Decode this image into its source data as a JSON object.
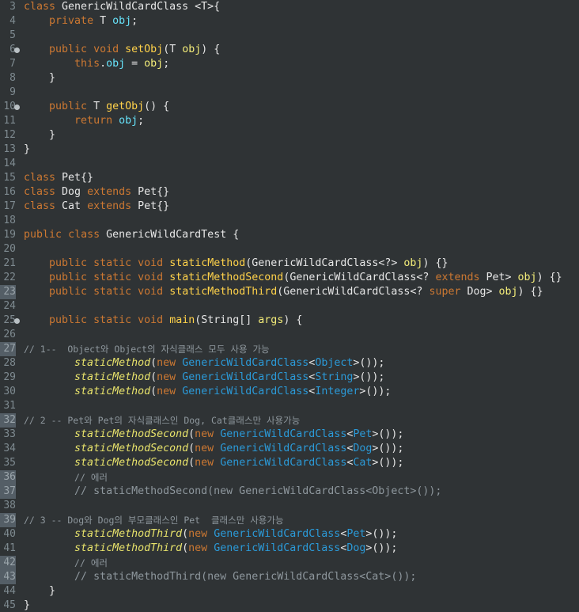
{
  "editor": {
    "lines": [
      {
        "no": "3",
        "fold": false,
        "hl": false,
        "tokens": [
          [
            "kw",
            "class"
          ],
          [
            "def",
            " GenericWildCardClass <T>{"
          ]
        ]
      },
      {
        "no": "4",
        "fold": false,
        "hl": false,
        "tokens": [
          [
            "def",
            "    "
          ],
          [
            "kw",
            "private"
          ],
          [
            "def",
            " T "
          ],
          [
            "field",
            "obj"
          ],
          [
            "def",
            ";"
          ]
        ]
      },
      {
        "no": "5",
        "fold": false,
        "hl": false,
        "tokens": []
      },
      {
        "no": "6",
        "fold": true,
        "hl": false,
        "tokens": [
          [
            "def",
            "    "
          ],
          [
            "kw",
            "public"
          ],
          [
            "def",
            " "
          ],
          [
            "kw",
            "void"
          ],
          [
            "def",
            " "
          ],
          [
            "methodx",
            "setObj"
          ],
          [
            "def",
            "(T "
          ],
          [
            "param",
            "obj"
          ],
          [
            "def",
            ") {"
          ]
        ]
      },
      {
        "no": "7",
        "fold": false,
        "hl": false,
        "tokens": [
          [
            "def",
            "        "
          ],
          [
            "kw",
            "this"
          ],
          [
            "def",
            "."
          ],
          [
            "field",
            "obj"
          ],
          [
            "def",
            " = "
          ],
          [
            "param",
            "obj"
          ],
          [
            "def",
            ";"
          ]
        ]
      },
      {
        "no": "8",
        "fold": false,
        "hl": false,
        "tokens": [
          [
            "def",
            "    }"
          ]
        ]
      },
      {
        "no": "9",
        "fold": false,
        "hl": false,
        "tokens": []
      },
      {
        "no": "10",
        "fold": true,
        "hl": false,
        "tokens": [
          [
            "def",
            "    "
          ],
          [
            "kw",
            "public"
          ],
          [
            "def",
            " T "
          ],
          [
            "methodx",
            "getObj"
          ],
          [
            "def",
            "() {"
          ]
        ]
      },
      {
        "no": "11",
        "fold": false,
        "hl": false,
        "tokens": [
          [
            "def",
            "        "
          ],
          [
            "kw",
            "return"
          ],
          [
            "def",
            " "
          ],
          [
            "field",
            "obj"
          ],
          [
            "def",
            ";"
          ]
        ]
      },
      {
        "no": "12",
        "fold": false,
        "hl": false,
        "tokens": [
          [
            "def",
            "    }"
          ]
        ]
      },
      {
        "no": "13",
        "fold": false,
        "hl": false,
        "tokens": [
          [
            "def",
            "}"
          ]
        ]
      },
      {
        "no": "14",
        "fold": false,
        "hl": false,
        "tokens": []
      },
      {
        "no": "15",
        "fold": false,
        "hl": false,
        "tokens": [
          [
            "kw",
            "class"
          ],
          [
            "def",
            " Pet{}"
          ]
        ]
      },
      {
        "no": "16",
        "fold": false,
        "hl": false,
        "tokens": [
          [
            "kw",
            "class"
          ],
          [
            "def",
            " Dog "
          ],
          [
            "kw",
            "extends"
          ],
          [
            "def",
            " Pet{}"
          ]
        ]
      },
      {
        "no": "17",
        "fold": false,
        "hl": false,
        "tokens": [
          [
            "kw",
            "class"
          ],
          [
            "def",
            " Cat "
          ],
          [
            "kw",
            "extends"
          ],
          [
            "def",
            " Pet{}"
          ]
        ]
      },
      {
        "no": "18",
        "fold": false,
        "hl": false,
        "tokens": []
      },
      {
        "no": "19",
        "fold": false,
        "hl": false,
        "tokens": [
          [
            "kw",
            "public"
          ],
          [
            "def",
            " "
          ],
          [
            "kw",
            "class"
          ],
          [
            "def",
            " GenericWildCardTest {"
          ]
        ]
      },
      {
        "no": "20",
        "fold": false,
        "hl": false,
        "tokens": []
      },
      {
        "no": "21",
        "fold": false,
        "hl": false,
        "tokens": [
          [
            "def",
            "    "
          ],
          [
            "kw",
            "public"
          ],
          [
            "def",
            " "
          ],
          [
            "kw",
            "static"
          ],
          [
            "def",
            " "
          ],
          [
            "kw",
            "void"
          ],
          [
            "def",
            " "
          ],
          [
            "methodx",
            "staticMethod"
          ],
          [
            "def",
            "(GenericWildCardClass<?> "
          ],
          [
            "param",
            "obj"
          ],
          [
            "def",
            ") {}"
          ]
        ]
      },
      {
        "no": "22",
        "fold": false,
        "hl": false,
        "tokens": [
          [
            "def",
            "    "
          ],
          [
            "kw",
            "public"
          ],
          [
            "def",
            " "
          ],
          [
            "kw",
            "static"
          ],
          [
            "def",
            " "
          ],
          [
            "kw",
            "void"
          ],
          [
            "def",
            " "
          ],
          [
            "methodx",
            "staticMethodSecond"
          ],
          [
            "def",
            "(GenericWildCardClass<? "
          ],
          [
            "kw",
            "extends"
          ],
          [
            "def",
            " Pet> "
          ],
          [
            "param",
            "obj"
          ],
          [
            "def",
            ") {}"
          ]
        ]
      },
      {
        "no": "23",
        "fold": false,
        "hl": true,
        "tokens": [
          [
            "def",
            "    "
          ],
          [
            "kw",
            "public"
          ],
          [
            "def",
            " "
          ],
          [
            "kw",
            "static"
          ],
          [
            "def",
            " "
          ],
          [
            "kw",
            "void"
          ],
          [
            "def",
            " "
          ],
          [
            "methodx",
            "staticMethodThird"
          ],
          [
            "def",
            "(GenericWildCardClass<? "
          ],
          [
            "kw",
            "super"
          ],
          [
            "def",
            " Dog> "
          ],
          [
            "param",
            "obj"
          ],
          [
            "def",
            ") {}"
          ]
        ]
      },
      {
        "no": "24",
        "fold": false,
        "hl": false,
        "tokens": []
      },
      {
        "no": "25",
        "fold": true,
        "hl": false,
        "tokens": [
          [
            "def",
            "    "
          ],
          [
            "kw",
            "public"
          ],
          [
            "def",
            " "
          ],
          [
            "kw",
            "static"
          ],
          [
            "def",
            " "
          ],
          [
            "kw",
            "void"
          ],
          [
            "def",
            " "
          ],
          [
            "methodx",
            "main"
          ],
          [
            "def",
            "(String[] "
          ],
          [
            "param",
            "args"
          ],
          [
            "def",
            ") {"
          ]
        ]
      },
      {
        "no": "26",
        "fold": false,
        "hl": false,
        "tokens": []
      },
      {
        "no": "27",
        "fold": false,
        "hl": true,
        "tokens": [
          [
            "comment",
            "// 1--  Object와 Object의 자식클래스 모두 사용 가능"
          ]
        ]
      },
      {
        "no": "28",
        "fold": false,
        "hl": false,
        "tokens": [
          [
            "def",
            "        "
          ],
          [
            "smethod",
            "staticMethod"
          ],
          [
            "def",
            "("
          ],
          [
            "kw",
            "new"
          ],
          [
            "def",
            " "
          ],
          [
            "gclass",
            "GenericWildCardClass"
          ],
          [
            "def",
            "<"
          ],
          [
            "gtype",
            "Object"
          ],
          [
            "def",
            ">());"
          ]
        ]
      },
      {
        "no": "29",
        "fold": false,
        "hl": false,
        "tokens": [
          [
            "def",
            "        "
          ],
          [
            "smethod",
            "staticMethod"
          ],
          [
            "def",
            "("
          ],
          [
            "kw",
            "new"
          ],
          [
            "def",
            " "
          ],
          [
            "gclass",
            "GenericWildCardClass"
          ],
          [
            "def",
            "<"
          ],
          [
            "gtype",
            "String"
          ],
          [
            "def",
            ">());"
          ]
        ]
      },
      {
        "no": "30",
        "fold": false,
        "hl": false,
        "tokens": [
          [
            "def",
            "        "
          ],
          [
            "smethod",
            "staticMethod"
          ],
          [
            "def",
            "("
          ],
          [
            "kw",
            "new"
          ],
          [
            "def",
            " "
          ],
          [
            "gclass",
            "GenericWildCardClass"
          ],
          [
            "def",
            "<"
          ],
          [
            "gtype",
            "Integer"
          ],
          [
            "def",
            ">());"
          ]
        ]
      },
      {
        "no": "31",
        "fold": false,
        "hl": false,
        "tokens": []
      },
      {
        "no": "32",
        "fold": false,
        "hl": true,
        "tokens": [
          [
            "comment",
            "// 2 -- Pet와 Pet의 자식클래스인 Dog, Cat클래스만 사용가능"
          ]
        ]
      },
      {
        "no": "33",
        "fold": false,
        "hl": false,
        "tokens": [
          [
            "def",
            "        "
          ],
          [
            "smethod",
            "staticMethodSecond"
          ],
          [
            "def",
            "("
          ],
          [
            "kw",
            "new"
          ],
          [
            "def",
            " "
          ],
          [
            "gclass",
            "GenericWildCardClass"
          ],
          [
            "def",
            "<"
          ],
          [
            "gtype",
            "Pet"
          ],
          [
            "def",
            ">());"
          ]
        ]
      },
      {
        "no": "34",
        "fold": false,
        "hl": false,
        "tokens": [
          [
            "def",
            "        "
          ],
          [
            "smethod",
            "staticMethodSecond"
          ],
          [
            "def",
            "("
          ],
          [
            "kw",
            "new"
          ],
          [
            "def",
            " "
          ],
          [
            "gclass",
            "GenericWildCardClass"
          ],
          [
            "def",
            "<"
          ],
          [
            "gtype",
            "Dog"
          ],
          [
            "def",
            ">());"
          ]
        ]
      },
      {
        "no": "35",
        "fold": false,
        "hl": false,
        "tokens": [
          [
            "def",
            "        "
          ],
          [
            "smethod",
            "staticMethodSecond"
          ],
          [
            "def",
            "("
          ],
          [
            "kw",
            "new"
          ],
          [
            "def",
            " "
          ],
          [
            "gclass",
            "GenericWildCardClass"
          ],
          [
            "def",
            "<"
          ],
          [
            "gtype",
            "Cat"
          ],
          [
            "def",
            ">());"
          ]
        ]
      },
      {
        "no": "36",
        "fold": false,
        "hl": true,
        "tokens": [
          [
            "def",
            "        "
          ],
          [
            "comment",
            "// 에러"
          ]
        ]
      },
      {
        "no": "37",
        "fold": false,
        "hl": true,
        "tokens": [
          [
            "def",
            "        "
          ],
          [
            "comment",
            "// staticMethodSecond(new GenericWildCardClass<Object>());"
          ]
        ]
      },
      {
        "no": "38",
        "fold": false,
        "hl": false,
        "tokens": []
      },
      {
        "no": "39",
        "fold": false,
        "hl": true,
        "tokens": [
          [
            "comment",
            "// 3 -- Dog와 Dog의 부모클래스인 Pet  클래스만 사용가능"
          ]
        ]
      },
      {
        "no": "40",
        "fold": false,
        "hl": false,
        "tokens": [
          [
            "def",
            "        "
          ],
          [
            "smethod",
            "staticMethodThird"
          ],
          [
            "def",
            "("
          ],
          [
            "kw",
            "new"
          ],
          [
            "def",
            " "
          ],
          [
            "gclass",
            "GenericWildCardClass"
          ],
          [
            "def",
            "<"
          ],
          [
            "gtype",
            "Pet"
          ],
          [
            "def",
            ">());"
          ]
        ]
      },
      {
        "no": "41",
        "fold": false,
        "hl": false,
        "tokens": [
          [
            "def",
            "        "
          ],
          [
            "smethod",
            "staticMethodThird"
          ],
          [
            "def",
            "("
          ],
          [
            "kw",
            "new"
          ],
          [
            "def",
            " "
          ],
          [
            "gclass",
            "GenericWildCardClass"
          ],
          [
            "def",
            "<"
          ],
          [
            "gtype",
            "Dog"
          ],
          [
            "def",
            ">());"
          ]
        ]
      },
      {
        "no": "42",
        "fold": false,
        "hl": true,
        "tokens": [
          [
            "def",
            "        "
          ],
          [
            "comment",
            "// 에러"
          ]
        ]
      },
      {
        "no": "43",
        "fold": false,
        "hl": true,
        "tokens": [
          [
            "def",
            "        "
          ],
          [
            "comment",
            "// staticMethodThird(new GenericWildCardClass<Cat>());"
          ]
        ]
      },
      {
        "no": "44",
        "fold": false,
        "hl": false,
        "tokens": [
          [
            "def",
            "    }"
          ]
        ]
      },
      {
        "no": "45",
        "fold": false,
        "hl": false,
        "tokens": [
          [
            "def",
            "}"
          ]
        ]
      }
    ]
  },
  "colors": {
    "background": "#2f3335",
    "keyword": "#cc7832",
    "method": "#ffd24a",
    "field": "#66e1f8",
    "param": "#f3ec79",
    "comment": "#8e979d",
    "static_method_call": "#e8e36b",
    "generic_class": "#2b9ad8"
  }
}
